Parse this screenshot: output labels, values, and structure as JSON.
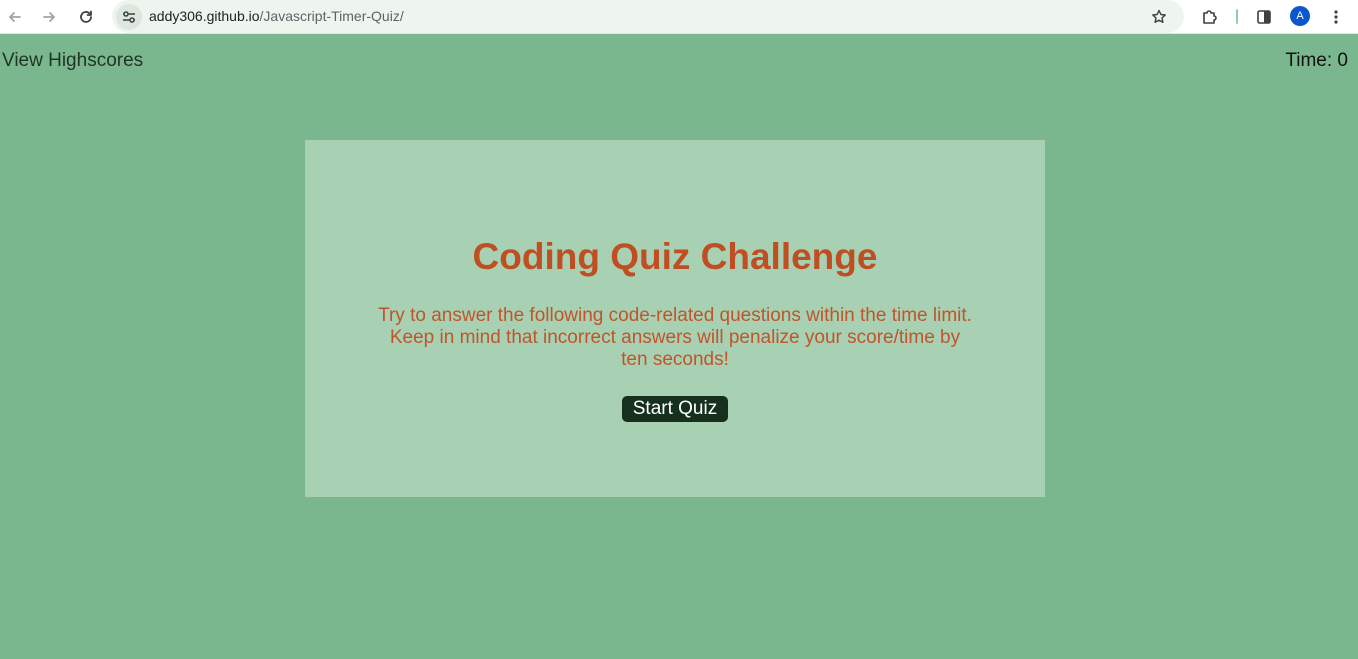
{
  "browser": {
    "url_host": "addy306.github.io",
    "url_path": "/Javascript-Timer-Quiz/",
    "avatar_letter": "A",
    "icons": {
      "back": "arrow-left-icon",
      "forward": "arrow-right-icon",
      "reload": "reload-icon",
      "site_info": "tune-icon",
      "bookmark": "star-icon",
      "extensions": "puzzle-icon",
      "side_panel": "side-panel-icon",
      "menu": "kebab-menu-icon"
    }
  },
  "header": {
    "highscores_label": "View Highscores",
    "timer_label": "Time: 0"
  },
  "quiz": {
    "title": "Coding Quiz Challenge",
    "description": "Try to answer the following code-related questions within the time limit. Keep in mind that incorrect answers will penalize your score/time by ten seconds!",
    "start_label": "Start Quiz"
  },
  "colors": {
    "page_background": "#7ab78f",
    "card_background": "#a8d0b2",
    "title": "#bf4f22",
    "button": "#16301e"
  }
}
